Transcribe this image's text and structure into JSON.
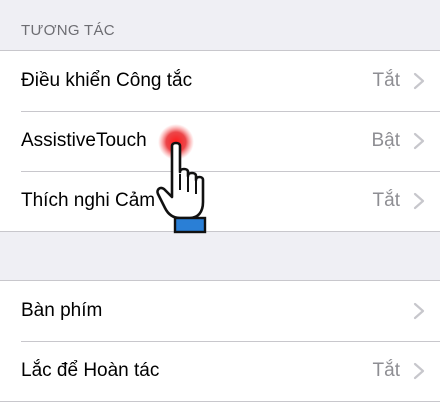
{
  "section": {
    "header": "TƯƠNG TÁC"
  },
  "group1": [
    {
      "label": "Điều khiển Công tắc",
      "value": "Tắt"
    },
    {
      "label": "AssistiveTouch",
      "value": "Bật"
    },
    {
      "label": "Thích nghi Cảm ứng",
      "value": "Tắt"
    }
  ],
  "group2": [
    {
      "label": "Bàn phím",
      "value": ""
    },
    {
      "label": "Lắc để Hoàn tác",
      "value": "Tắt"
    }
  ],
  "icons": {
    "chevron": "chevron-right-icon",
    "cursor": "hand-pointer-icon",
    "touch": "touch-indicator-icon"
  },
  "colors": {
    "touch": "#e8262a",
    "cuff": "#2a7fd6"
  }
}
